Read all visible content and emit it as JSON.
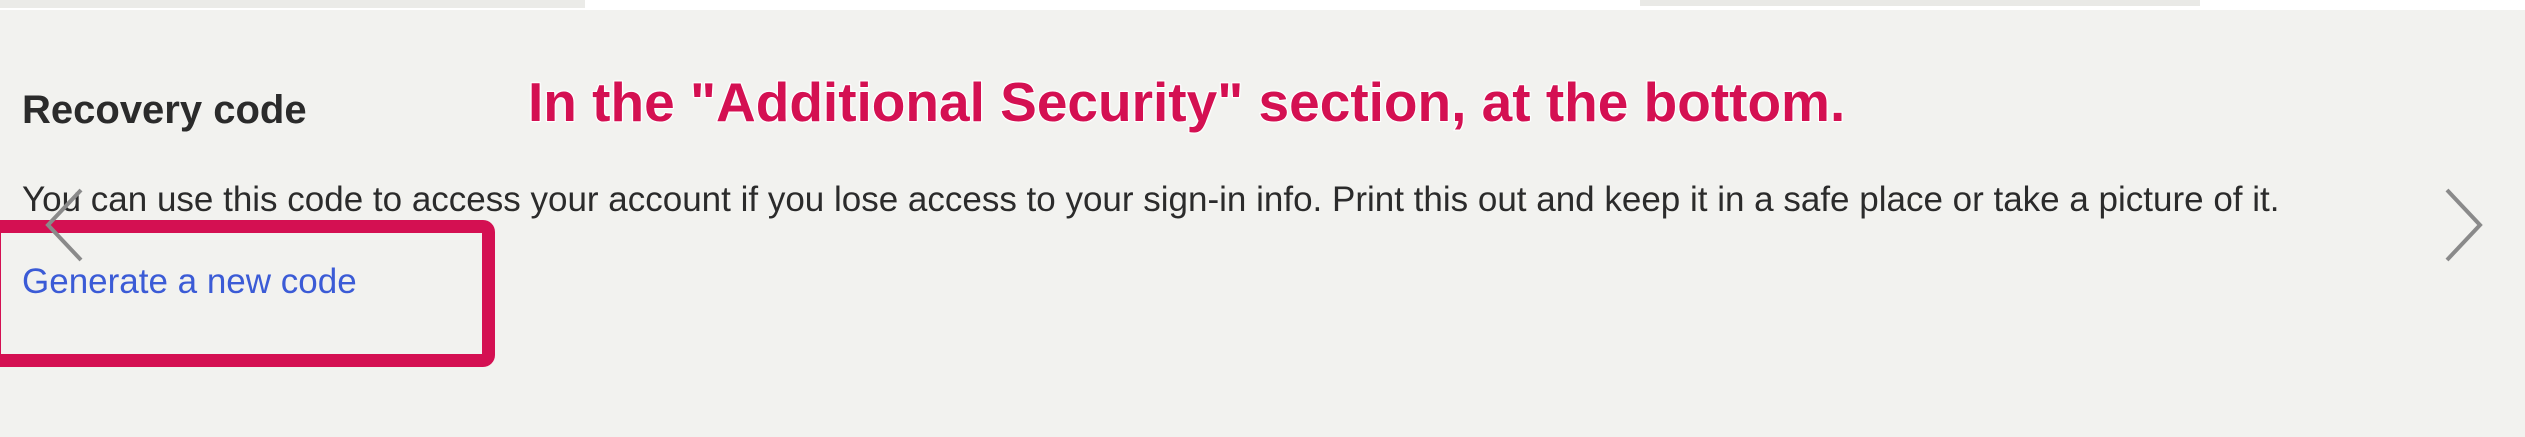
{
  "section": {
    "title": "Recovery code",
    "description": "You can use this code to access your account if you lose access to your sign-in info. Print this out and keep it in a safe place or take a picture of it.",
    "link_label": "Generate a new code"
  },
  "annotation": {
    "text": "In the \"Additional Security\" section, at the bottom."
  },
  "nav": {
    "prev_icon": "chevron-left-icon",
    "next_icon": "chevron-right-icon"
  },
  "colors": {
    "background": "#f2f2ef",
    "annotation": "#d41052",
    "link": "#3b5bd6",
    "text": "#2b2b2b"
  }
}
